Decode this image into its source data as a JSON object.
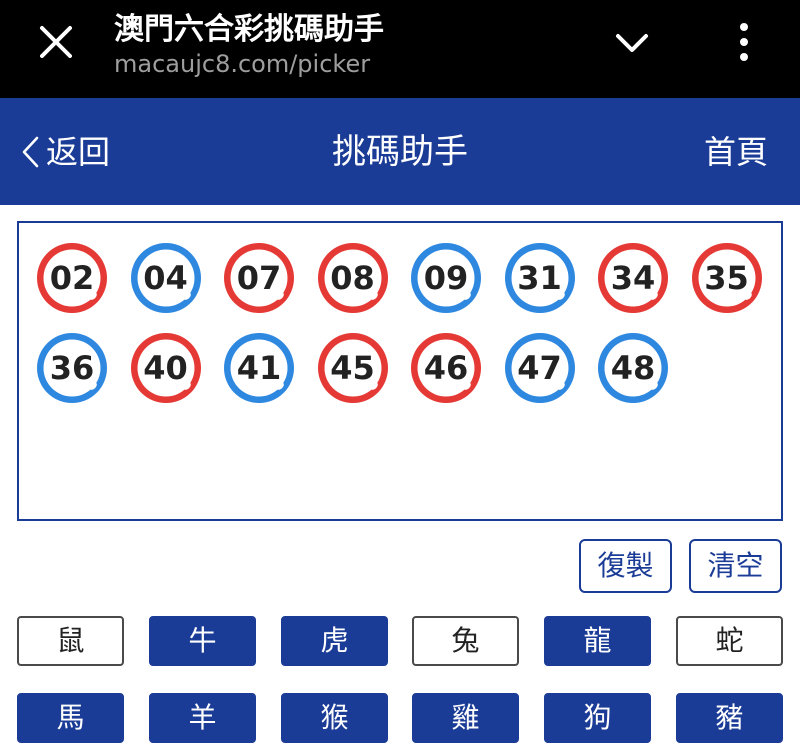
{
  "browser": {
    "title": "澳門六合彩挑碼助手",
    "url": "macaujc8.com/picker"
  },
  "header": {
    "back_label": "返回",
    "title": "挑碼助手",
    "home_label": "首頁"
  },
  "selected_numbers": [
    {
      "num": "02",
      "color": "#e53935"
    },
    {
      "num": "04",
      "color": "#2e88e0"
    },
    {
      "num": "07",
      "color": "#e53935"
    },
    {
      "num": "08",
      "color": "#e53935"
    },
    {
      "num": "09",
      "color": "#2e88e0"
    },
    {
      "num": "31",
      "color": "#2e88e0"
    },
    {
      "num": "34",
      "color": "#e53935"
    },
    {
      "num": "35",
      "color": "#e53935"
    },
    {
      "num": "36",
      "color": "#2e88e0"
    },
    {
      "num": "40",
      "color": "#e53935"
    },
    {
      "num": "41",
      "color": "#2e88e0"
    },
    {
      "num": "45",
      "color": "#e53935"
    },
    {
      "num": "46",
      "color": "#e53935"
    },
    {
      "num": "47",
      "color": "#2e88e0"
    },
    {
      "num": "48",
      "color": "#2e88e0"
    }
  ],
  "actions": {
    "copy_label": "復製",
    "clear_label": "清空"
  },
  "zodiac": [
    {
      "label": "鼠",
      "selected": false
    },
    {
      "label": "牛",
      "selected": true
    },
    {
      "label": "虎",
      "selected": true
    },
    {
      "label": "兔",
      "selected": false
    },
    {
      "label": "龍",
      "selected": true
    },
    {
      "label": "蛇",
      "selected": false
    },
    {
      "label": "馬",
      "selected": true
    },
    {
      "label": "羊",
      "selected": true
    },
    {
      "label": "猴",
      "selected": true
    },
    {
      "label": "雞",
      "selected": true
    },
    {
      "label": "狗",
      "selected": true
    },
    {
      "label": "豬",
      "selected": true
    }
  ],
  "colors": {
    "primary": "#1b3c96",
    "ball_red": "#e53935",
    "ball_blue": "#2e88e0"
  }
}
